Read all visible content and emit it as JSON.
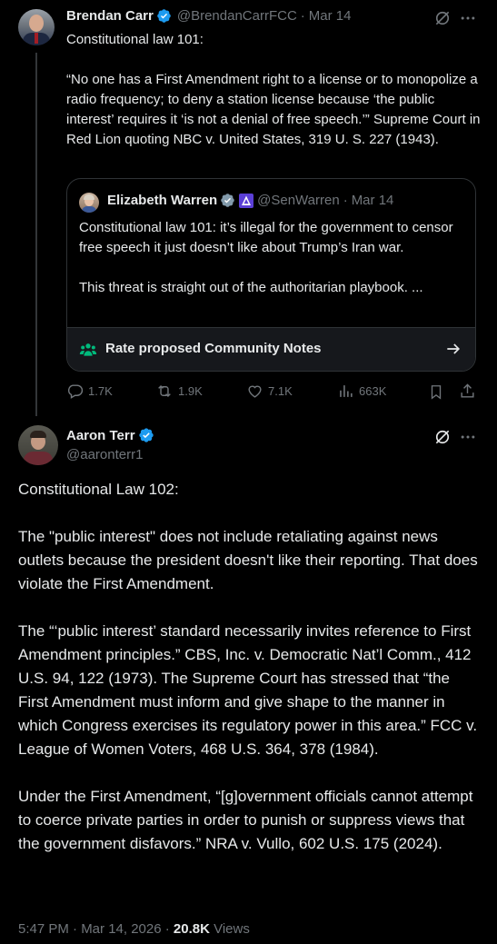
{
  "parent_tweet": {
    "author_name": "Brendan Carr",
    "handle": "@BrendanCarrFCC",
    "separator": "·",
    "date": "Mar 14",
    "text": "Constitutional law 101:\n\n“No one has a First Amendment right to a license or to monopolize a radio frequency; to deny a station license because ‘the public interest’ requires it ‘is not a denial of free speech.’” Supreme Court in Red Lion quoting NBC v. United States, 319 U. S. 227 (1943).",
    "quoted_tweet": {
      "author_name": "Elizabeth Warren",
      "handle": "@SenWarren",
      "separator": "·",
      "date": "Mar 14",
      "text": "Constitutional law 101: it’s illegal for the government to censor free speech it just doesn’t like about Trump’s Iran war.\n\nThis threat is straight out of the authoritarian playbook. ...",
      "community_notes_label": "Rate proposed Community Notes"
    },
    "stats": {
      "replies": "1.7K",
      "reposts": "1.9K",
      "likes": "7.1K",
      "views": "663K"
    }
  },
  "main_tweet": {
    "author_name": "Aaron Terr",
    "handle": "@aaronterr1",
    "text": "Constitutional Law 102:\n\nThe \"public interest\" does not include retaliating against news outlets because the president doesn't like their reporting. That does violate the First Amendment.\n\nThe “‘public interest’ standard necessarily invites reference to First Amendment principles.” CBS, Inc. v. Democratic Nat’l Comm., 412 U.S. 94, 122 (1973). The Supreme Court has stressed that “the First Amendment must inform and give shape to the manner in which Congress exercises its regulatory power in this area.” FCC v. League of Women Voters, 468 U.S. 364, 378 (1984).\n\nUnder the First Amendment, “[g]overnment officials cannot attempt to coerce private parties in order to punish or suppress views that the government disfavors.” NRA v. Vullo, 602 U.S. 175 (2024).",
    "timestamp": "5:47 PM · Mar 14, 2026 · ",
    "views_count": "20.8K",
    "views_label": " Views"
  },
  "colors": {
    "background": "#000000",
    "text": "#e7e9ea",
    "muted": "#71767b",
    "verified": "#1d9bf0",
    "community_notes": "#00ba7c"
  },
  "icons": [
    "grok-icon",
    "more-icon",
    "verified-badge-icon",
    "community-notes-icon",
    "arrow-right-icon",
    "reply-icon",
    "repost-icon",
    "like-icon",
    "views-icon",
    "bookmark-icon",
    "share-icon"
  ]
}
